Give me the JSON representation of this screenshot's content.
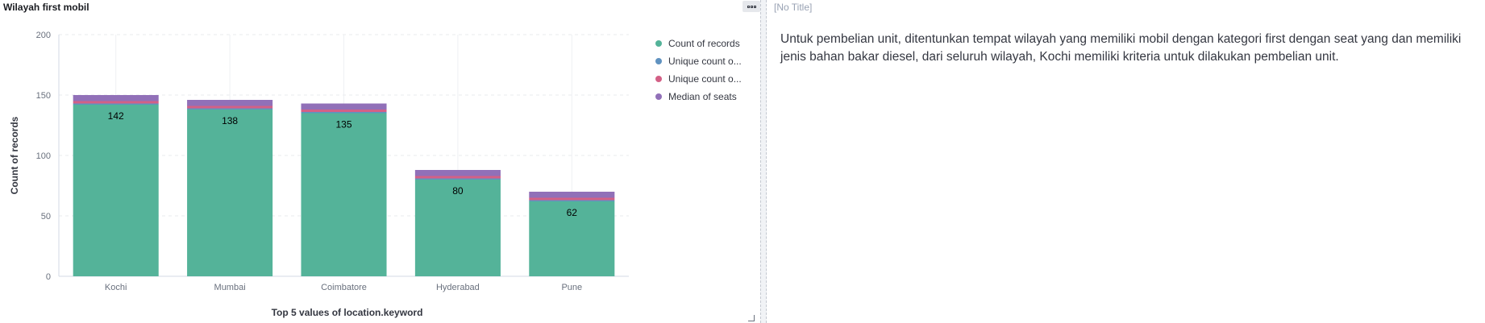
{
  "left_panel": {
    "title": "Wilayah first mobil"
  },
  "right_panel": {
    "title": "[No Title]",
    "text": "Untuk pembelian unit, ditentunkan tempat wilayah yang memiliki mobil dengan kategori first dengan seat yang dan memiliki jenis bahan bakar diesel, dari seluruh wilayah, Kochi memiliki kriteria untuk dilakukan pembelian unit."
  },
  "legend": [
    {
      "label": "Count of records",
      "color": "#54b399"
    },
    {
      "label": "Unique count o...",
      "color": "#6092c0"
    },
    {
      "label": "Unique count o...",
      "color": "#d36086"
    },
    {
      "label": "Median of seats",
      "color": "#9170b8"
    }
  ],
  "chart_data": {
    "type": "bar",
    "stacked": true,
    "categories": [
      "Kochi",
      "Mumbai",
      "Coimbatore",
      "Hyderabad",
      "Pune"
    ],
    "series": [
      {
        "name": "Count of records",
        "values": [
          142,
          138,
          135,
          80,
          62
        ],
        "color": "#54b399"
      },
      {
        "name": "Unique count o...",
        "values": [
          1,
          1,
          1,
          1,
          1
        ],
        "color": "#6092c0"
      },
      {
        "name": "Unique count o...",
        "values": [
          2,
          2,
          2,
          2,
          2
        ],
        "color": "#d36086"
      },
      {
        "name": "Median of seats",
        "values": [
          5,
          5,
          5,
          5,
          5
        ],
        "color": "#9170b8"
      }
    ],
    "data_labels": [
      142,
      138,
      135,
      80,
      62
    ],
    "xlabel": "Top 5 values of location.keyword",
    "ylabel": "Count of records",
    "ylim": [
      0,
      200
    ],
    "yticks": [
      0,
      50,
      100,
      150,
      200
    ],
    "grid": true,
    "legend_position": "right"
  }
}
